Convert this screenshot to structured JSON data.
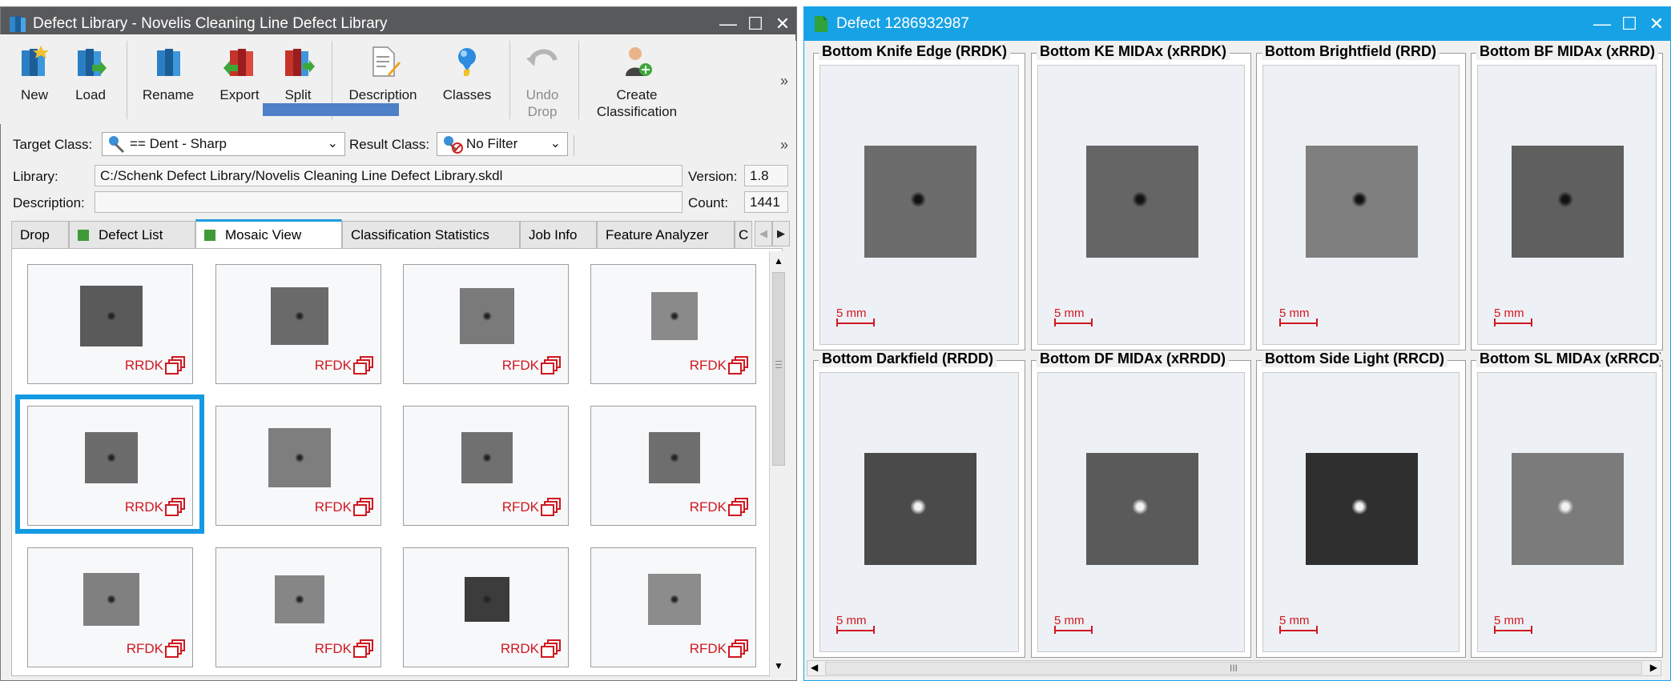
{
  "left_window": {
    "title": "Defect Library - Novelis Cleaning Line Defect Library",
    "controls": {
      "minimize": "—",
      "maximize": "☐",
      "close": "✕"
    },
    "toolbar": {
      "new": "New",
      "load": "Load",
      "rename": "Rename",
      "export": "Export",
      "split": "Split",
      "description": "Description",
      "classes": "Classes",
      "undo_drop_1": "Undo",
      "undo_drop_2": "Drop",
      "create_class_1": "Create",
      "create_class_2": "Classification",
      "overflow": "»"
    },
    "filter": {
      "target_label": "Target Class:",
      "target_value": "== Dent - Sharp",
      "result_label": "Result Class:",
      "result_value": "No Filter",
      "overflow": "»"
    },
    "library": {
      "label": "Library:",
      "path": "C:/Schenk Defect Library/Novelis Cleaning Line Defect Library.skdl",
      "version_label": "Version:",
      "version": "1.8"
    },
    "description": {
      "label": "Description:",
      "value": "",
      "count_label": "Count:",
      "count": "1441"
    },
    "tabs": [
      "Drop",
      "Defect List",
      "Mosaic View",
      "Classification Statistics",
      "Job Info",
      "Feature Analyzer",
      "C"
    ],
    "mosaic": [
      {
        "label": "RRDK"
      },
      {
        "label": "RFDK"
      },
      {
        "label": "RFDK"
      },
      {
        "label": "RFDK"
      },
      {
        "label": "RRDK"
      },
      {
        "label": "RFDK"
      },
      {
        "label": "RFDK"
      },
      {
        "label": "RFDK"
      },
      {
        "label": "RFDK"
      },
      {
        "label": "RFDK"
      },
      {
        "label": "RRDK"
      },
      {
        "label": "RFDK"
      }
    ]
  },
  "right_window": {
    "title": "Defect 1286932987",
    "controls": {
      "minimize": "—",
      "maximize": "☐",
      "close": "✕"
    },
    "sections": [
      {
        "title": "Bottom Knife Edge (RRDK)",
        "scale": "5 mm",
        "tone": "#6c6c6c"
      },
      {
        "title": "Bottom KE MIDAx (xRRDK)",
        "scale": "5 mm",
        "tone": "#656565"
      },
      {
        "title": "Bottom Brightfield (RRD)",
        "scale": "5 mm",
        "tone": "#7f7f7f"
      },
      {
        "title": "Bottom BF MIDAx (xRRD)",
        "scale": "5 mm",
        "tone": "#5f5f5f"
      },
      {
        "title": "Bottom Darkfield (RRDD)",
        "scale": "5 mm",
        "tone": "#4a4a4a"
      },
      {
        "title": "Bottom DF MIDAx (xRRDD)",
        "scale": "5 mm",
        "tone": "#5a5a5a"
      },
      {
        "title": "Bottom Side Light (RRCD)",
        "scale": "5 mm",
        "tone": "#2f2f2f"
      },
      {
        "title": "Bottom SL MIDAx (xRRCD)",
        "scale": "5 mm",
        "tone": "#7b7b7b"
      }
    ],
    "scrollbar_grip": "III"
  }
}
